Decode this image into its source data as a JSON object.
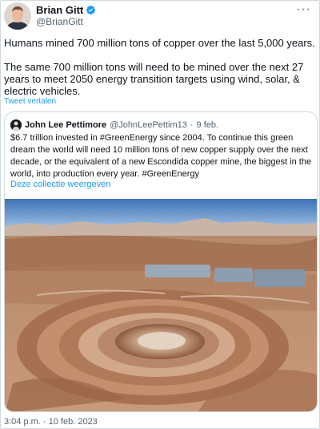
{
  "author": {
    "name": "Brian Gitt",
    "handle": "@BrianGitt"
  },
  "tweet": {
    "paragraphs": [
      "Humans mined 700 million tons of copper over the last 5,000 years.",
      "The same 700 million tons will need to be mined over the next 27 years to meet 2050 energy transition targets using wind, solar, & electric vehicles."
    ],
    "translate_label": "Tweet vertalen",
    "timestamp": "3:04 p.m. · 10 feb. 2023"
  },
  "quote": {
    "name": "John Lee Pettimore",
    "handle": "@JohnLeePettim13",
    "separator": "·",
    "date": "9 feb.",
    "text": "$6.7 trillion invested in #GreenEnergy since 2004. To continue this green dream the world will need 10 million tons of new copper supply over the next decade, or the equivalent of a new Escondida copper mine, the biggest in the world, into production every year. #GreenEnergy",
    "collection_link": "Deze collectie weergeven"
  },
  "colors": {
    "accent": "#1d9bf0",
    "secondary_text": "#536471",
    "border": "#cfd9de"
  },
  "icons": {
    "verified": "verified-badge-icon",
    "more": "more-options-icon"
  }
}
